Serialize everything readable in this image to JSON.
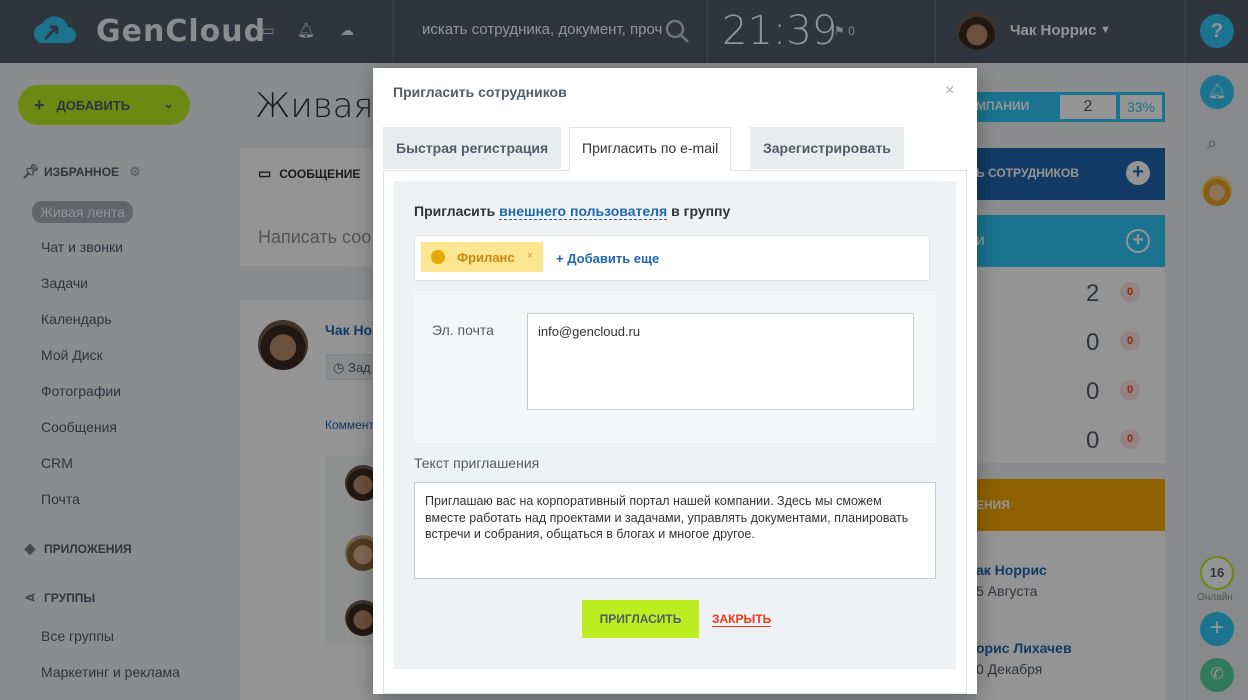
{
  "topbar": {
    "logo": "GenCloud",
    "search_placeholder": "искать сотрудника, документ, проч",
    "time": "21:39",
    "flag_count": "0",
    "user_name": "Чак Норрис",
    "help": "?"
  },
  "sidebar": {
    "add_label": "ДОБАВИТЬ",
    "favorites_title": "ИЗБРАННОЕ",
    "items": [
      "Живая лента",
      "Чат и звонки",
      "Задачи",
      "Календарь",
      "Мой Диск",
      "Фотографии",
      "Сообщения",
      "CRM",
      "Почта"
    ],
    "apps_title": "ПРИЛОЖЕНИЯ",
    "groups_title": "ГРУППЫ",
    "group_items": [
      "Все группы",
      "Маркетинг и реклама"
    ]
  },
  "main": {
    "page_title": "Живая л",
    "post_tab": "СООБЩЕНИЕ",
    "post_placeholder": "Написать соо",
    "feed_author": "Чак Но",
    "feed_chip": "Зад",
    "feed_comment": "Коммент"
  },
  "right_panel": {
    "stat_label": "МПАНИИ",
    "stat_num": "2",
    "stat_pct": "33%",
    "invite_label": "Ь СОТРУДНИКОВ",
    "cyan_label": "И",
    "rows": [
      "2",
      "0",
      "0",
      "0"
    ],
    "badges": [
      "0",
      "0",
      "0",
      "0"
    ],
    "orange_label": "ЕНИЯ",
    "bdays": [
      {
        "name": "ак Норрис",
        "date": "5 Августа"
      },
      {
        "name": "орис Лихачев",
        "date": "0 Декабря"
      }
    ]
  },
  "rail": {
    "online_count": "16",
    "online_label": "Онлайн"
  },
  "modal": {
    "title": "Пригласить сотрудников",
    "tabs": [
      "Быстрая регистрация",
      "Пригласить по e-mail",
      "Зарегистрировать"
    ],
    "heading_pre": "Пригласить ",
    "heading_link": "внешнего пользователя",
    "heading_post": " в группу",
    "group_chip": "Фриланс",
    "add_more": "Добавить еще",
    "email_label": "Эл. почта",
    "email_value": "info@gencloud.ru",
    "message_label": "Текст приглашения",
    "message_value": "Приглашаю вас на корпоративный портал нашей компании. Здесь мы сможем вместе работать над проектами и задачами, управлять документами, планировать встречи и собрания, общаться в блогах и многое другое.",
    "invite_button": "ПРИГЛАСИТЬ",
    "close_link": "ЗАКРЫТЬ"
  },
  "colors": {
    "accent_green": "#bbed21",
    "accent_blue": "#2fc6f6",
    "link_blue": "#2067b0",
    "topbar": "#535c69"
  }
}
